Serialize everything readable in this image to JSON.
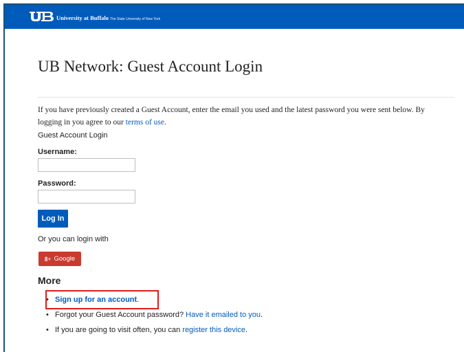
{
  "header": {
    "brand_name": "University at Buffalo",
    "brand_subtitle": "The State University of New York",
    "logo_icon": "ub-logo-icon",
    "bar_color": "#005bbb"
  },
  "page": {
    "title": "UB Network: Guest Account Login",
    "intro_text_1": "If you have previously created a Guest Account, enter the email you used and the latest password you were sent below. By logging in you agree to our ",
    "terms_link": "terms of use",
    "intro_text_2": "."
  },
  "form": {
    "title": "Guest Account Login",
    "username_label": "Username:",
    "username_value": "",
    "password_label": "Password:",
    "password_value": "",
    "login_button": "Log In"
  },
  "alt_login": {
    "text": "Or you can login with",
    "google_icon": "google-plus-icon",
    "google_glyph": "8+",
    "google_label": "Google",
    "google_color": "#c93a2f"
  },
  "more": {
    "title": "More",
    "item1_link": "Sign up for an account",
    "item1_suffix": ".",
    "item2_text": "Forgot your Guest Account password? ",
    "item2_link": "Have it emailed to you",
    "item2_suffix": ".",
    "item3_text": "If you are going to visit often, you can ",
    "item3_link": "register this device",
    "item3_suffix": ".",
    "highlight_color": "#e01a1a"
  },
  "accent_color": "#005bbb"
}
